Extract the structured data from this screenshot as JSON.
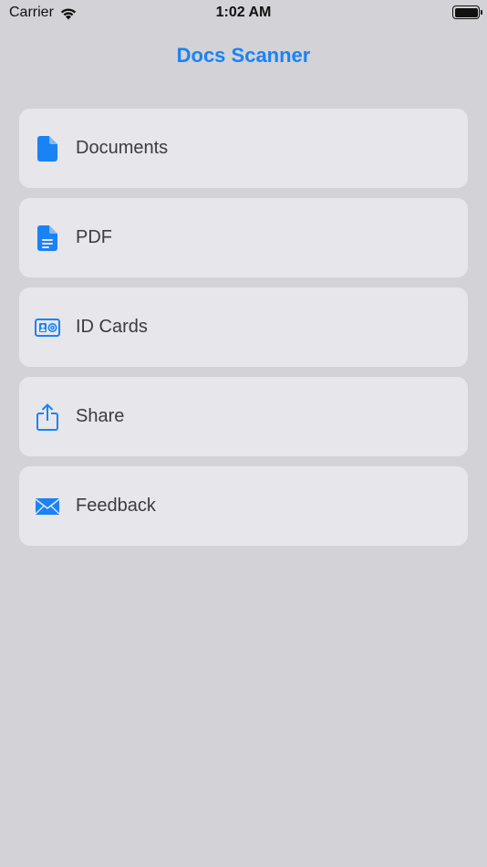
{
  "status_bar": {
    "carrier": "Carrier",
    "time": "1:02 AM",
    "wifi_icon": "wifi-icon",
    "battery_icon": "battery-icon"
  },
  "nav": {
    "title": "Docs Scanner"
  },
  "accent_color": "#1a82f5",
  "menu": {
    "items": [
      {
        "label": "Documents",
        "icon": "document-icon"
      },
      {
        "label": "PDF",
        "icon": "pdf-document-icon"
      },
      {
        "label": "ID Cards",
        "icon": "id-card-icon"
      },
      {
        "label": "Share",
        "icon": "share-icon"
      },
      {
        "label": "Feedback",
        "icon": "envelope-icon"
      }
    ]
  }
}
